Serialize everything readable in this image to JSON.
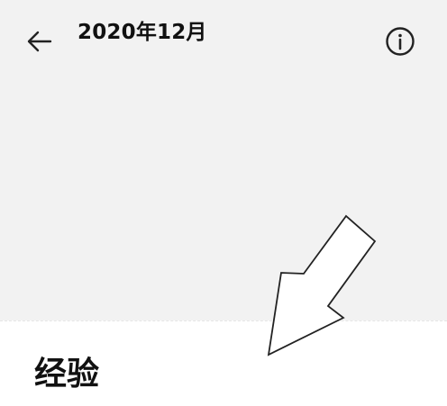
{
  "header": {
    "title": "2020年12月",
    "back_icon": "back-arrow-icon",
    "info_icon": "info-icon"
  },
  "section": {
    "heading": "经验"
  },
  "overlay": {
    "icon": "pointer-arrow-icon"
  },
  "colors": {
    "top_background": "#f2f2f2",
    "page_background": "#ffffff",
    "text": "#111111"
  }
}
